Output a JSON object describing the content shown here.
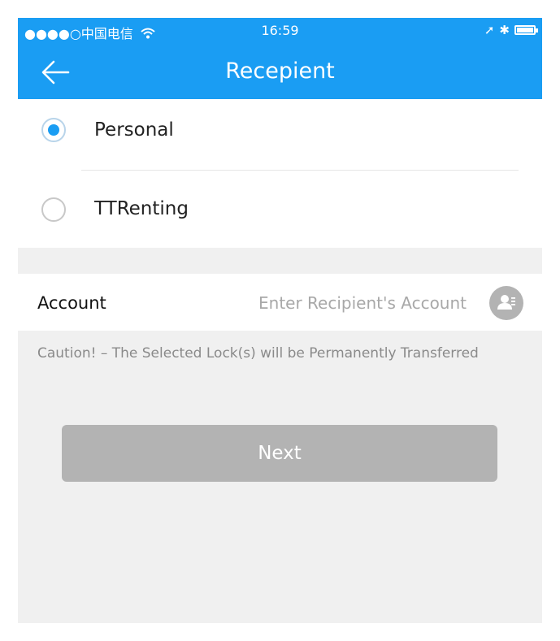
{
  "status_bar": {
    "carrier": "●●●●○中国电信",
    "time": "16:59",
    "location_glyph": "➚",
    "bluetooth_glyph": "✱",
    "icons": [
      "wifi-icon",
      "location-icon",
      "bluetooth-icon",
      "battery-icon"
    ]
  },
  "nav": {
    "title": "Recepient",
    "back_icon": "back-arrow-icon"
  },
  "options": [
    {
      "label": "Personal",
      "selected": true
    },
    {
      "label": "TTRenting",
      "selected": false
    }
  ],
  "account": {
    "label": "Account",
    "placeholder": "Enter Recipient's Account",
    "value": "",
    "contact_icon": "contact-book-icon"
  },
  "caution": "Caution! – The Selected Lock(s) will be Permanently Transferred",
  "next_button": "Next",
  "colors": {
    "accent": "#1a9df3",
    "background": "#f0f0f0",
    "disabled_button": "#b3b3b3"
  }
}
